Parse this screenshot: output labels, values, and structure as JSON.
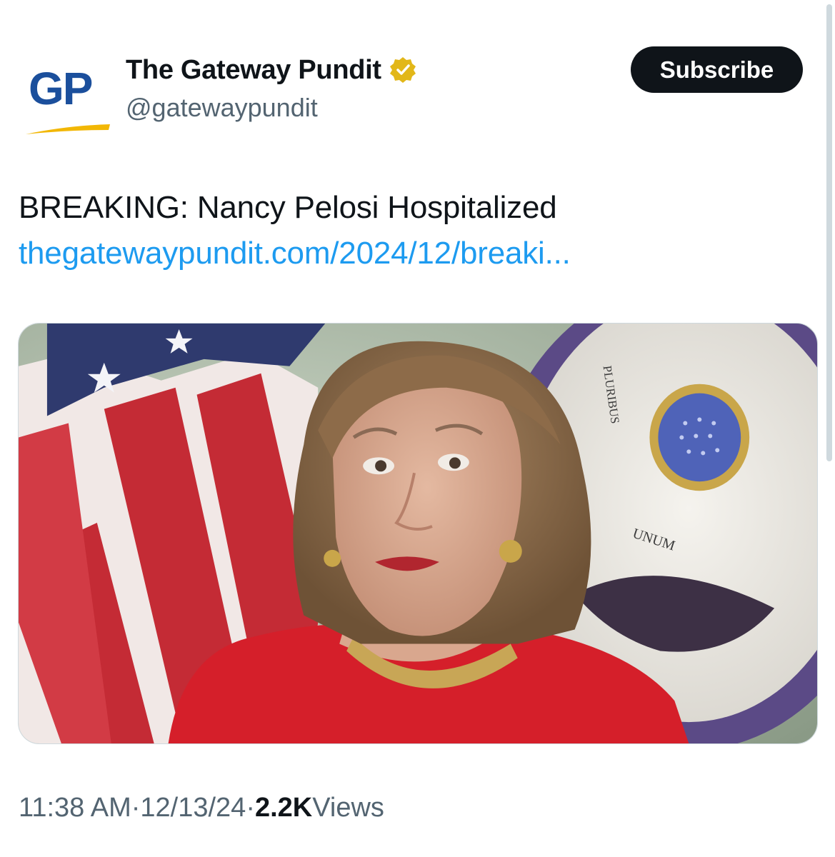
{
  "account": {
    "logo_text": "GP",
    "name": "The Gateway Pundit",
    "handle": "@gatewaypundit",
    "verified_badge": "gold-verified-icon"
  },
  "subscribe_button": {
    "label": "Subscribe"
  },
  "tweet": {
    "text": "BREAKING: Nancy Pelosi Hospitalized",
    "link": "thegatewaypundit.com/2024/12/breaki..."
  },
  "media": {
    "seal_text_1": "PLURIBUS",
    "seal_text_2": "UNUM"
  },
  "meta": {
    "time": "11:38 AM",
    "separator": " · ",
    "date": "12/13/24",
    "views_count": "2.2K",
    "views_label": " Views"
  },
  "colors": {
    "link": "#1d9bf0",
    "secondary_text": "#536471",
    "primary_text": "#0f1419",
    "verified_gold": "#e2b719",
    "logo_blue": "#1b4f9c",
    "logo_gold": "#f2b705"
  }
}
